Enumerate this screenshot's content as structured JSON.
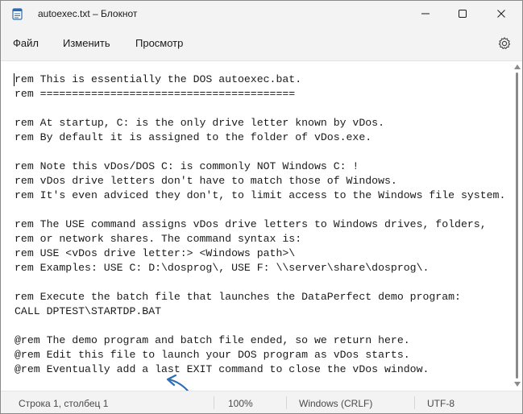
{
  "window": {
    "title": "autoexec.txt – Блокнот",
    "icon": "notepad-icon"
  },
  "menu": {
    "file": "Файл",
    "edit": "Изменить",
    "view": "Просмотр",
    "settings_icon": "gear-icon"
  },
  "editor": {
    "lines": [
      "rem This is essentially the DOS autoexec.bat.",
      "rem ========================================",
      "",
      "rem At startup, C: is the only drive letter known by vDos.",
      "rem By default it is assigned to the folder of vDos.exe.",
      "",
      "rem Note this vDos/DOS C: is commonly NOT Windows C: !",
      "rem vDos drive letters don't have to match those of Windows.",
      "rem It's even adviced they don't, to limit access to the Windows file system.",
      "",
      "rem The USE command assigns vDos drive letters to Windows drives, folders,",
      "rem or network shares. The command syntax is:",
      "rem USE <vDos drive letter:> <Windows path>\\",
      "rem Examples: USE C: D:\\dosprog\\, USE F: \\\\server\\share\\dosprog\\.",
      "",
      "rem Execute the batch file that launches the DataPerfect demo program:",
      "CALL DPTEST\\STARTDP.BAT",
      "",
      "@rem The demo program and batch file ended, so we return here.",
      "@rem Edit this file to launch your DOS program as vDos starts.",
      "@rem Eventually add a last EXIT command to close the vDos window."
    ]
  },
  "status": {
    "position": "Строка 1, столбец 1",
    "zoom": "100%",
    "line_endings": "Windows (CRLF)",
    "encoding": "UTF-8"
  },
  "colors": {
    "annotation_arrow": "#2f6db5",
    "chrome": "#f3f3f3",
    "editor_bg": "#ffffff"
  }
}
